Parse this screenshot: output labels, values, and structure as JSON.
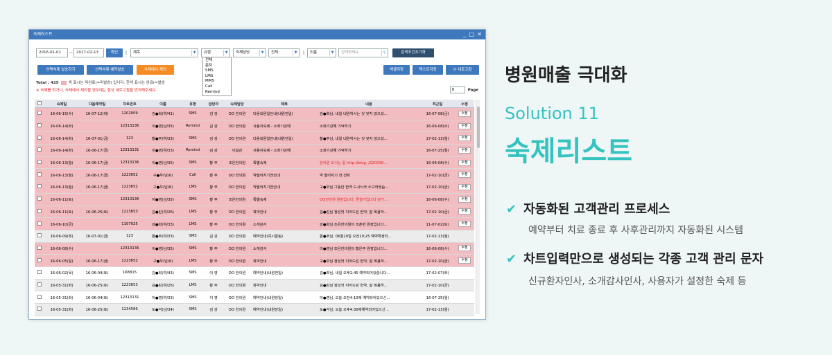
{
  "window": {
    "title": "숙제리스트",
    "controls": [
      "_",
      "□",
      "✕"
    ]
  },
  "filters": {
    "date_from": "2016-01-01",
    "date_sep": "~",
    "date_to": "2017-02-13",
    "confirm": "확인",
    "category": "제목",
    "type": "유형",
    "manager": "숙제담당",
    "status": "전체",
    "name_field": "이름",
    "search_placeholder": "검색하세요",
    "reset": "검색조건초기화"
  },
  "type_options": [
    "전체",
    "문자",
    "SMS",
    "LMS",
    "MMS",
    "Call",
    "Remind"
  ],
  "actions": {
    "send_selected": "선택숙제 발송하기",
    "reserve_selected": "선택숙제 예약발송",
    "remove": "숙제에서 제외",
    "excel": "엑셀저장",
    "text": "텍스트저장",
    "refresh": "새로고침"
  },
  "info": {
    "total": "Total : 425",
    "legend": "색 표시는 미완료(=미발송) 입니다. 한색 표시는 완료(=발송",
    "warning": "※ 숙제를 하거나, 숙제에서 제외할 경우에는 항상 새로고침을 먼저해주세요."
  },
  "pager": {
    "size": "8",
    "label": "Page"
  },
  "columns": [
    "",
    "숙제일",
    "다음예약일",
    "차트번호",
    "이름",
    "유형",
    "담당자",
    "숙제담당",
    "제목",
    "내용",
    "최근일",
    "수정"
  ],
  "rows": [
    {
      "s": "pink",
      "d": "16-06-15(수)",
      "n": "16-07-12(화)",
      "chart": "1202009",
      "name": "김●희(여/41)",
      "type": "SMS",
      "staff": "김 강",
      "mgr": "OO 한의원",
      "title": "다음내원일안내(내원전일)",
      "content": "김●희님, 내일 내원하시는 것 잊지 않으셨...",
      "last": "16-07-08(금)",
      "edit": "수정"
    },
    {
      "s": "pink",
      "d": "16-06-14(화)",
      "n": "",
      "chart": "12313136",
      "name": "이●영(남/35)",
      "type": "Remind",
      "staff": "김 강",
      "mgr": "OO 한의원",
      "title": "사용자숙제 - 소화기강예",
      "content": "소화기강예 기억하기",
      "last": "16-06-08(수)",
      "edit": "수정"
    },
    {
      "s": "pink",
      "d": "16-06-14(화)",
      "n": "16-07-01(금)",
      "chart": "123",
      "name": "황●주(여/33)",
      "type": "SMS",
      "staff": "김 강",
      "mgr": "OO 한의원",
      "title": "다음내원일안내(내원전일)",
      "content": "황●주님, 내일 내원하시는 것 잊지 않으셨...",
      "last": "17-02-13(월)",
      "edit": "수정"
    },
    {
      "s": "pink",
      "d": "16-06-14(화)",
      "n": "16-06-17(금)",
      "chart": "12313131",
      "name": "이●영(여/33)",
      "type": "Remind",
      "staff": "김 강",
      "mgr": "이설강",
      "title": "사용자숙제 - 소화기강예",
      "content": "소화기강예 기억하기",
      "last": "16-07-25(월)",
      "edit": "수정"
    },
    {
      "s": "pink",
      "d": "16-06-13(월)",
      "n": "16-06-17(금)",
      "chart": "12313136",
      "name": "이●영(남/35)",
      "type": "SMS",
      "staff": "황 주",
      "mgr": "조은한의원",
      "title": "특별숙제",
      "content": "한의원 오시는 길 http://blog.          /220036...",
      "last": "16-06-08(수)",
      "edit": "수정",
      "red": true
    },
    {
      "s": "pink",
      "d": "16-06-13(월)",
      "n": "16-06-17(금)",
      "chart": "1223652",
      "name": "구●우(남/6)",
      "type": "Call",
      "staff": "황 주",
      "mgr": "OO 한의원",
      "title": "약떨어지기전안내",
      "content": "약 떨어지기 전 전화",
      "last": "17-02-10(금)",
      "edit": "수정"
    },
    {
      "s": "pink",
      "d": "16-06-13(월)",
      "n": "16-06-17(금)",
      "chart": "1223652",
      "name": "구●우(남/6)",
      "type": "LMS",
      "staff": "황 주",
      "mgr": "OO 한의원",
      "title": "약떨어지기전안내",
      "content": "구●우님 그동안 한약 드시느라 수고하셨슴...",
      "last": "17-02-10(금)",
      "edit": "수정"
    },
    {
      "s": "pink",
      "d": "16-06-11(토)",
      "n": "",
      "chart": "12313136",
      "name": "이●영(남/35)",
      "type": "SMS",
      "staff": "황 주",
      "mgr": "조은한의원",
      "title": "특별숙제",
      "content": "OO한의원 원장입니다. 편찮기입니다 감기...",
      "last": "16-06-08(수)",
      "edit": "수정",
      "red": true
    },
    {
      "s": "pink",
      "d": "16-06-11(토)",
      "n": "16-06-25(토)",
      "chart": "1223653",
      "name": "김●린(여/26)",
      "type": "LMS",
      "staff": "황 주",
      "mgr": "OO 한의원",
      "title": "복약안내",
      "content": "김●린님 정성껏 지어드린 한약, 잘 복용하...",
      "last": "17-02-10(금)",
      "edit": "수정"
    },
    {
      "s": "pink",
      "d": "16-06-10(금)",
      "n": "",
      "chart": "1107025",
      "name": "강●희(여/33)",
      "type": "LMS",
      "staff": "황 주",
      "mgr": "OO 한의원",
      "title": "소개감사",
      "content": "강●희님 조은한의원의 조훈현 원장입니다...",
      "last": "11-07-02(토)",
      "edit": "수정"
    },
    {
      "s": "gray",
      "d": "16-06-09(목)",
      "n": "16-07-01(금)",
      "chart": "123",
      "name": "황●주(여/33)",
      "type": "SMS",
      "staff": "김 강",
      "mgr": "OO 한의원",
      "title": "예약안내(즉시알림)",
      "content": "황●주님, 06월10일 오전10:25 예약확정되...",
      "last": "17-02-13(월)",
      "edit": ""
    },
    {
      "s": "pink",
      "d": "16-06-08(수)",
      "n": "",
      "chart": "12313136",
      "name": "이●영(남/35)",
      "type": "SMS",
      "staff": "황 주",
      "mgr": "OO 한의원",
      "title": "소개감사",
      "content": "이●영님 조은한의원의 황은주 원장입니다...",
      "last": "16-06-08(수)",
      "edit": "수정"
    },
    {
      "s": "pink",
      "d": "16-06-05(일)",
      "n": "16-06-17(금)",
      "chart": "1223652",
      "name": "구●우(남/6)",
      "type": "LMS",
      "staff": "황 주",
      "mgr": "OO 한의원",
      "title": "복약안내",
      "content": "구●우님 정성껏 지어드린 한약, 잘 복용하...",
      "last": "17-02-10(금)",
      "edit": "수정"
    },
    {
      "s": "white",
      "d": "16-06-02(목)",
      "n": "16-06-04(토)",
      "chart": "168815",
      "name": "김●희(여/43)",
      "type": "SMS",
      "staff": "이 영",
      "mgr": "OO 한의원",
      "title": "예약안내(내원전일)",
      "content": "김●희님, 내일 오후2:45 예약되어있습니다...",
      "last": "17-02-07(화)",
      "edit": ""
    },
    {
      "s": "gray",
      "d": "16-05-31(화)",
      "n": "16-06-25(토)",
      "chart": "1223653",
      "name": "김●린(여/26)",
      "type": "LMS",
      "staff": "황 주",
      "mgr": "OO 한의원",
      "title": "복약안내",
      "content": "김●린님 정성껏 지어드린 한약, 잘 복용하...",
      "last": "17-02-10(금)",
      "edit": ""
    },
    {
      "s": "white",
      "d": "16-05-31(화)",
      "n": "16-06-04(토)",
      "chart": "12313131",
      "name": "이●영(여/33)",
      "type": "SMS",
      "staff": "이 영",
      "mgr": "OO 한의원",
      "title": "예약안내(내원당일)",
      "content": "이●영님, 오늘 오전4:10에 예약되어있으신...",
      "last": "16-07-25(월)",
      "edit": ""
    },
    {
      "s": "gray",
      "d": "16-05-31(화)",
      "n": "16-06-25(토)",
      "chart": "1234586",
      "name": "도●석(남/34)",
      "type": "SMS",
      "staff": "김 강",
      "mgr": "OO 한의원",
      "title": "예약안내(내원당일)",
      "content": "도●석님, 오늘 오후4:30에예약되어있으신...",
      "last": "17-02-13(월)",
      "edit": ""
    }
  ],
  "promo": {
    "headline": "병원매출 극대화",
    "solution": "Solution 11",
    "product": "숙제리스트",
    "bullet1": "자동화된 고객관리 프로세스",
    "sub1": "예약부터 치료 종료 후 사후관리까지 자동화된 시스템",
    "bullet2": "차트입력만으로 생성되는 각종 고객 관리 문자",
    "sub2": "신규환자인사, 소개감사인사, 사용자가 설정한 숙제 등",
    "check": "✔"
  },
  "colors": {
    "accent": "#35c3c0",
    "titlebar": "#3f79bd",
    "incomplete": "#f2bcc0",
    "orange": "#f58b22"
  }
}
